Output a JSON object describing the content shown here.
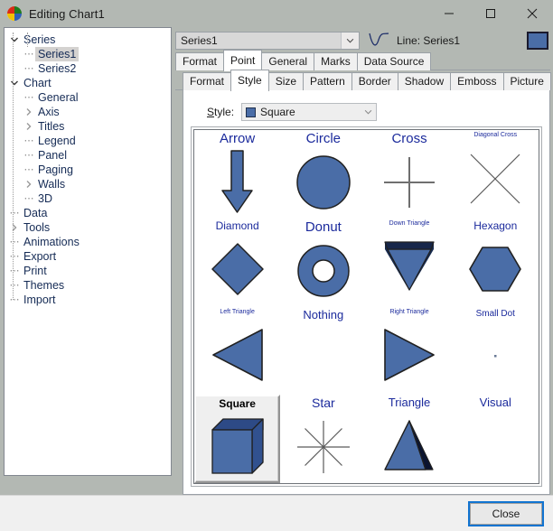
{
  "window": {
    "title": "Editing Chart1",
    "icon": "chart-app-icon",
    "minimize_label": "─",
    "maximize_label": "□",
    "close_label": "✕"
  },
  "sidebar": {
    "items": [
      {
        "label": "Series",
        "level": 0,
        "expander": "down",
        "selected": false
      },
      {
        "label": "Series1",
        "level": 1,
        "expander": "none",
        "selected": true
      },
      {
        "label": "Series2",
        "level": 1,
        "expander": "none",
        "selected": false
      },
      {
        "label": "Chart",
        "level": 0,
        "expander": "down",
        "selected": false
      },
      {
        "label": "General",
        "level": 1,
        "expander": "none",
        "selected": false
      },
      {
        "label": "Axis",
        "level": 1,
        "expander": "right",
        "selected": false
      },
      {
        "label": "Titles",
        "level": 1,
        "expander": "right",
        "selected": false
      },
      {
        "label": "Legend",
        "level": 1,
        "expander": "none",
        "selected": false
      },
      {
        "label": "Panel",
        "level": 1,
        "expander": "none",
        "selected": false
      },
      {
        "label": "Paging",
        "level": 1,
        "expander": "none",
        "selected": false
      },
      {
        "label": "Walls",
        "level": 1,
        "expander": "right",
        "selected": false
      },
      {
        "label": "3D",
        "level": 1,
        "expander": "none",
        "selected": false
      },
      {
        "label": "Data",
        "level": 0,
        "expander": "none",
        "selected": false
      },
      {
        "label": "Tools",
        "level": 0,
        "expander": "right",
        "selected": false
      },
      {
        "label": "Animations",
        "level": 0,
        "expander": "none",
        "selected": false
      },
      {
        "label": "Export",
        "level": 0,
        "expander": "none",
        "selected": false
      },
      {
        "label": "Print",
        "level": 0,
        "expander": "none",
        "selected": false
      },
      {
        "label": "Themes",
        "level": 0,
        "expander": "none",
        "selected": false
      },
      {
        "label": "Import",
        "level": 0,
        "expander": "none",
        "selected": false
      }
    ]
  },
  "series_bar": {
    "combo_value": "Series1",
    "combo_icon": "chevron-down-icon",
    "line_icon": "line-curve-icon",
    "line_label": "Line: Series1",
    "color_swatch": "#4A6DA7"
  },
  "tabs_primary": [
    {
      "label": "Format",
      "active": false
    },
    {
      "label": "Point",
      "active": true
    },
    {
      "label": "General",
      "active": false
    },
    {
      "label": "Marks",
      "active": false
    },
    {
      "label": "Data Source",
      "active": false
    }
  ],
  "tabs_secondary": [
    {
      "label": "Format",
      "active": false
    },
    {
      "label": "Style",
      "active": true
    },
    {
      "label": "Size",
      "active": false
    },
    {
      "label": "Pattern",
      "active": false
    },
    {
      "label": "Border",
      "active": false
    },
    {
      "label": "Shadow",
      "active": false
    },
    {
      "label": "Emboss",
      "active": false
    },
    {
      "label": "Picture",
      "active": false
    }
  ],
  "style_field": {
    "label": "Style:",
    "label_accesskey": "S",
    "label_rest": "tyle:",
    "value": "Square",
    "value_icon": "blue-square-icon",
    "dropdown_icon": "chevron-down-icon"
  },
  "shape_grid": {
    "shapes": [
      {
        "label": "Arrow",
        "shape": "arrow-down",
        "label_size": 15,
        "selected": false
      },
      {
        "label": "Circle",
        "shape": "circle",
        "label_size": 15,
        "selected": false
      },
      {
        "label": "Cross",
        "shape": "cross",
        "label_size": 15,
        "selected": false
      },
      {
        "label": "Diagonal Cross",
        "shape": "diagonal-cross",
        "label_size": 7,
        "selected": false
      },
      {
        "label": "Diamond",
        "shape": "diamond",
        "label_size": 12,
        "selected": false
      },
      {
        "label": "Donut",
        "shape": "donut",
        "label_size": 15,
        "selected": false
      },
      {
        "label": "Down Triangle",
        "shape": "down-triangle",
        "label_size": 7,
        "selected": false
      },
      {
        "label": "Hexagon",
        "shape": "hexagon",
        "label_size": 12,
        "selected": false
      },
      {
        "label": "Left Triangle",
        "shape": "left-triangle",
        "label_size": 7,
        "selected": false
      },
      {
        "label": "Nothing",
        "shape": "nothing",
        "label_size": 13,
        "selected": false
      },
      {
        "label": "Right Triangle",
        "shape": "right-triangle",
        "label_size": 7,
        "selected": false
      },
      {
        "label": "Small Dot",
        "shape": "small-dot",
        "label_size": 10,
        "selected": false
      },
      {
        "label": "Square",
        "shape": "cube",
        "label_size": 12,
        "selected": true
      },
      {
        "label": "Star",
        "shape": "star",
        "label_size": 14,
        "selected": false
      },
      {
        "label": "Triangle",
        "shape": "pyramid",
        "label_size": 13,
        "selected": false
      },
      {
        "label": "Visual",
        "shape": "none",
        "label_size": 13,
        "selected": false
      }
    ],
    "shape_fill": "#4A6DA7",
    "shape_stroke": "#202020",
    "label_color": "#1B2A9C"
  },
  "footer": {
    "close_label": "Close"
  }
}
